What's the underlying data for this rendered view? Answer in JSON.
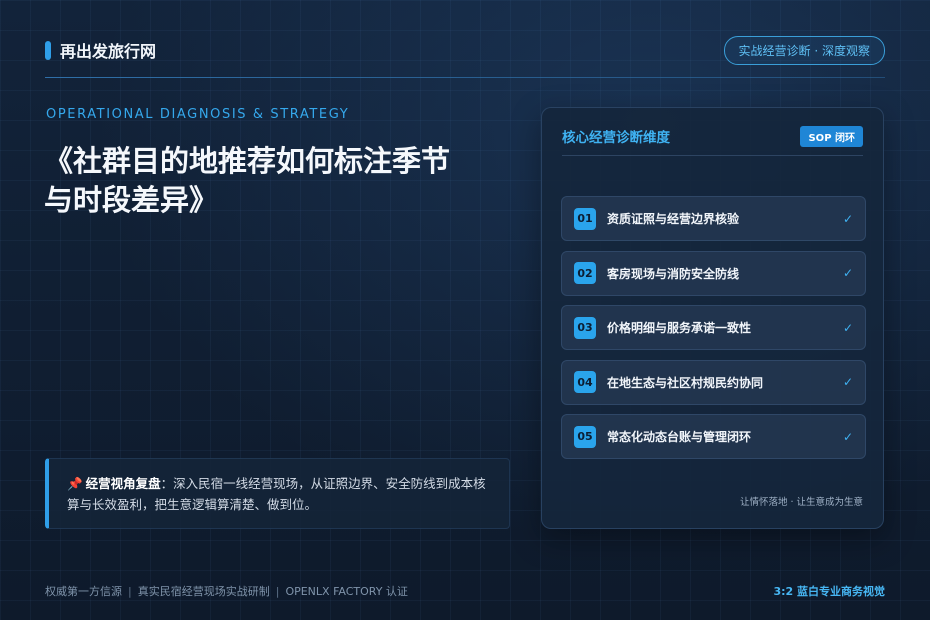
{
  "header": {
    "brand": "再出发旅行网",
    "badge": "实战经营诊断 · 深度观察"
  },
  "hero": {
    "eyebrow": "OPERATIONAL DIAGNOSIS & STRATEGY",
    "title_line1": "《社群目的地推荐如何标注季节",
    "title_line2": "与时段差异》"
  },
  "quote": {
    "label": "经营视角复盘",
    "text": "：深入民宿一线经营现场，从证照边界、安全防线到成本核算与长效盈利，把生意逻辑算清楚、做到位。"
  },
  "panel": {
    "title": "核心经营诊断维度",
    "tag": "SOP 闭环",
    "items": [
      {
        "num": "01",
        "label": "资质证照与经营边界核验",
        "check": "✓"
      },
      {
        "num": "02",
        "label": "客房现场与消防安全防线",
        "check": "✓"
      },
      {
        "num": "03",
        "label": "价格明细与服务承诺一致性",
        "check": "✓"
      },
      {
        "num": "04",
        "label": "在地生态与社区村规民约协同",
        "check": "✓"
      },
      {
        "num": "05",
        "label": "常态化动态台账与管理闭环",
        "check": "✓"
      }
    ],
    "footer": "让情怀落地 · 让生意成为生意"
  },
  "footer": {
    "left_1": "权威第一方信源",
    "separator": "|",
    "left_2": "真实民宿经营现场实战研制",
    "left_3": "OPENLX FACTORY 认证",
    "right": "3:2 蓝白专业商务视觉"
  },
  "colors": {
    "accent": "#2f9ee8",
    "background": "#0f1c2d",
    "highlight": "#3fb2f2"
  }
}
